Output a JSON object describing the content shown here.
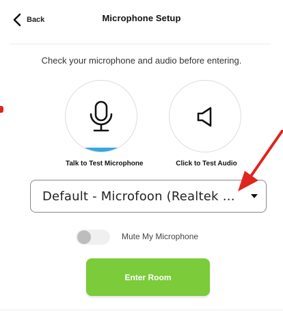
{
  "header": {
    "back_label": "Back",
    "title": "Microphone Setup"
  },
  "instructions": "Check your microphone and audio before entering.",
  "test_mic": {
    "label": "Talk to Test Microphone",
    "icon": "microphone-icon"
  },
  "test_audio": {
    "label": "Click to Test Audio",
    "icon": "speaker-icon"
  },
  "device_select": {
    "value": "Default - Microfoon (Realtek Audio)"
  },
  "mute": {
    "label": "Mute My Microphone",
    "enabled": false
  },
  "enter_button": {
    "label": "Enter Room"
  },
  "colors": {
    "accent_green": "#7ccb3a",
    "mic_level_blue": "#35a8e0",
    "annotation_red": "#e0241f"
  }
}
